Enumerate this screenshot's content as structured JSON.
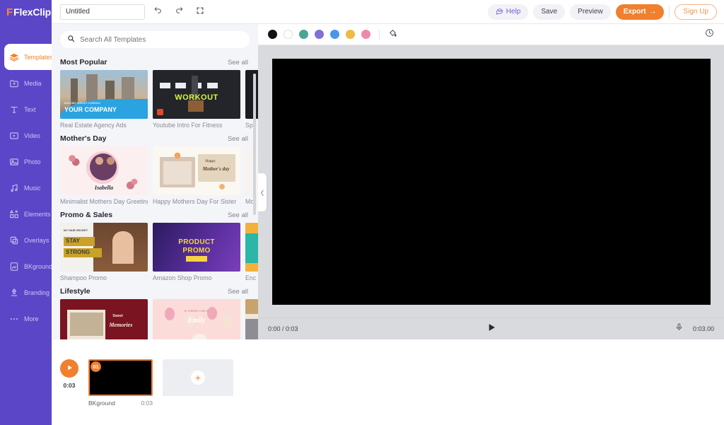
{
  "app": {
    "name": "FlexClip",
    "logo_mark": "F"
  },
  "topbar": {
    "project_title": "Untitled",
    "project_placeholder": "Untitled",
    "undo": "undo-icon",
    "redo": "redo-icon",
    "fullscreen": "fullscreen-icon",
    "help_label": "Help",
    "save_label": "Save",
    "preview_label": "Preview",
    "export_label": "Export",
    "export_arrow": "→",
    "signup_label": "Sign Up"
  },
  "sidebar": {
    "items": [
      {
        "label": "Templates",
        "icon": "templates-icon",
        "active": true
      },
      {
        "label": "Media",
        "icon": "media-icon",
        "active": false
      },
      {
        "label": "Text",
        "icon": "text-icon",
        "active": false
      },
      {
        "label": "Video",
        "icon": "video-icon",
        "active": false
      },
      {
        "label": "Photo",
        "icon": "photo-icon",
        "active": false
      },
      {
        "label": "Music",
        "icon": "music-icon",
        "active": false
      },
      {
        "label": "Elements",
        "icon": "elements-icon",
        "active": false
      },
      {
        "label": "Overlays",
        "icon": "overlays-icon",
        "active": false
      },
      {
        "label": "BKground",
        "icon": "background-icon",
        "active": false
      },
      {
        "label": "Branding",
        "icon": "branding-icon",
        "active": false
      },
      {
        "label": "More",
        "icon": "more-icon",
        "active": false
      }
    ]
  },
  "panel": {
    "search_placeholder": "Search All Templates",
    "search_value": "",
    "see_all_label": "See all",
    "collapse_icon": "chevron-left-icon",
    "sections": [
      {
        "title": "Most Popular",
        "cards": [
          {
            "name": "Real Estate Agency Ads"
          },
          {
            "name": "Youtube Intro For Fitness"
          },
          {
            "name": "Spo"
          }
        ]
      },
      {
        "title": "Mother's Day",
        "cards": [
          {
            "name": "Minimalist Mothers Day Greeting"
          },
          {
            "name": "Happy Mothers Day For Sister"
          },
          {
            "name": "Mo"
          }
        ]
      },
      {
        "title": "Promo & Sales",
        "cards": [
          {
            "name": "Shampoo Promo"
          },
          {
            "name": "Amazon Shop Promo"
          },
          {
            "name": "Enc"
          }
        ]
      },
      {
        "title": "Lifestyle",
        "cards": [
          {
            "name": ""
          },
          {
            "name": ""
          },
          {
            "name": ""
          }
        ]
      }
    ]
  },
  "stage": {
    "swatches": [
      {
        "name": "black",
        "hex": "#111111"
      },
      {
        "name": "white",
        "hex": "#ffffff"
      },
      {
        "name": "teal",
        "hex": "#47a694"
      },
      {
        "name": "purple",
        "hex": "#8170d6"
      },
      {
        "name": "blue",
        "hex": "#4a95e8"
      },
      {
        "name": "gold",
        "hex": "#eeb947"
      },
      {
        "name": "pink",
        "hex": "#ed8aab"
      }
    ],
    "bucket_icon": "paint-bucket-icon",
    "history_icon": "history-clock-icon",
    "canvas_color": "#000000"
  },
  "player": {
    "current_total": "0:00 / 0:03",
    "play_icon": "play-icon",
    "mic_icon": "microphone-icon",
    "duration": "0:03.00"
  },
  "timeline": {
    "preview_duration": "0:03",
    "play_icon": "play-icon",
    "clips": [
      {
        "badge": "01",
        "name": "BKground",
        "duration": "0:03"
      }
    ],
    "add_label": "+"
  },
  "colors": {
    "brand_purple": "#5b46c8",
    "brand_orange": "#f0802e",
    "panel_bg": "#f4f5f8",
    "stage_bg": "#d8dade"
  }
}
